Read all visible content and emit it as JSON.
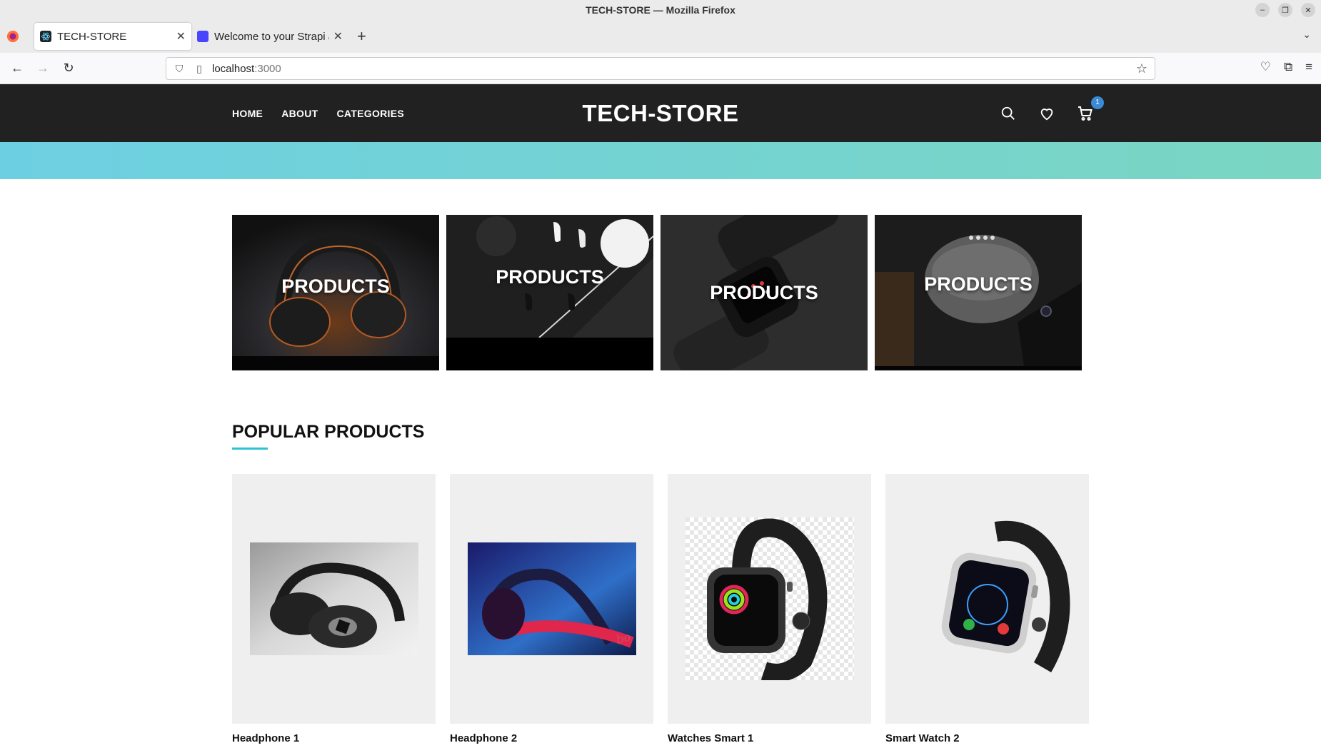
{
  "window": {
    "title": "TECH-STORE — Mozilla Firefox"
  },
  "tabs": [
    {
      "label": "TECH-STORE",
      "active": true
    },
    {
      "label": "Welcome to your Strapi a",
      "active": false
    }
  ],
  "address": {
    "host": "localhost",
    "port": ":3000"
  },
  "site": {
    "logo": "TECH-STORE",
    "nav": [
      "HOME",
      "ABOUT",
      "CATEGORIES"
    ],
    "cart_count": "1",
    "accent": "#2dc2d2"
  },
  "categories": [
    {
      "label": "PRODUCTS",
      "icon": "headphones-photo"
    },
    {
      "label": "PRODUCTS",
      "icon": "earbuds-photo"
    },
    {
      "label": "PRODUCTS",
      "icon": "smartwatch-photo"
    },
    {
      "label": "PRODUCTS",
      "icon": "smart-speaker-photo"
    }
  ],
  "popular": {
    "title": "POPULAR PRODUCTS",
    "products": [
      {
        "name": "Headphone 1",
        "icon": "headphone-image"
      },
      {
        "name": "Headphone 2",
        "icon": "headphone-image"
      },
      {
        "name": "Watches Smart 1",
        "icon": "smartwatch-image"
      },
      {
        "name": "Smart Watch 2",
        "icon": "smartwatch-image"
      }
    ]
  }
}
